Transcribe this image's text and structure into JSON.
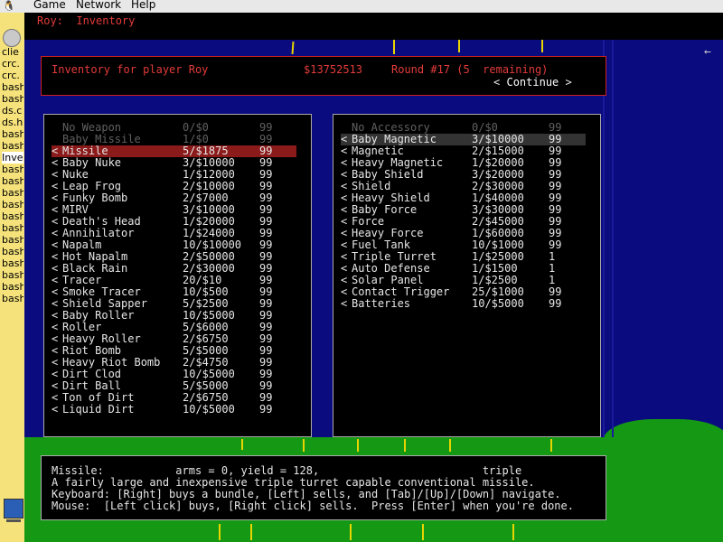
{
  "menubar": {
    "items": [
      "Game",
      "Network",
      "Help"
    ]
  },
  "taskbar": {
    "items": [
      "clie",
      "crc.",
      "crc.",
      "bash",
      "bash",
      "ds.c",
      "ds.h",
      "bash",
      "bash",
      "Inve",
      "bash",
      "bash",
      "bash",
      "bash",
      "bash",
      "bash",
      "bash",
      "bash",
      "bash",
      "bash",
      "bash",
      "bash"
    ]
  },
  "game": {
    "breadcrumb_player": "Roy:",
    "breadcrumb_section": "Inventory",
    "header": {
      "title": "Inventory for player Roy",
      "money": "$13752513",
      "round": "Round #17 (5  remaining)",
      "continue_label": "Continue"
    },
    "weapons": [
      {
        "name": "No Weapon",
        "price": "0/$0",
        "qty": "99",
        "state": "dim"
      },
      {
        "name": "Baby Missile",
        "price": "1/$0",
        "qty": "99",
        "state": "dim"
      },
      {
        "name": "Missile",
        "price": "5/$1875",
        "qty": "99",
        "state": "sel"
      },
      {
        "name": "Baby Nuke",
        "price": "3/$10000",
        "qty": "99",
        "state": ""
      },
      {
        "name": "Nuke",
        "price": "1/$12000",
        "qty": "99",
        "state": ""
      },
      {
        "name": "Leap Frog",
        "price": "2/$10000",
        "qty": "99",
        "state": ""
      },
      {
        "name": "Funky Bomb",
        "price": "2/$7000",
        "qty": "99",
        "state": ""
      },
      {
        "name": "MIRV",
        "price": "3/$10000",
        "qty": "99",
        "state": ""
      },
      {
        "name": "Death's Head",
        "price": "1/$20000",
        "qty": "99",
        "state": ""
      },
      {
        "name": "Annihilator",
        "price": "1/$24000",
        "qty": "99",
        "state": ""
      },
      {
        "name": "Napalm",
        "price": "10/$10000",
        "qty": "99",
        "state": ""
      },
      {
        "name": "Hot Napalm",
        "price": "2/$50000",
        "qty": "99",
        "state": ""
      },
      {
        "name": "Black Rain",
        "price": "2/$30000",
        "qty": "99",
        "state": ""
      },
      {
        "name": "Tracer",
        "price": "20/$10",
        "qty": "99",
        "state": ""
      },
      {
        "name": "Smoke Tracer",
        "price": "10/$500",
        "qty": "99",
        "state": ""
      },
      {
        "name": "Shield Sapper",
        "price": "5/$2500",
        "qty": "99",
        "state": ""
      },
      {
        "name": "Baby Roller",
        "price": "10/$5000",
        "qty": "99",
        "state": ""
      },
      {
        "name": "Roller",
        "price": "5/$6000",
        "qty": "99",
        "state": ""
      },
      {
        "name": "Heavy Roller",
        "price": "2/$6750",
        "qty": "99",
        "state": ""
      },
      {
        "name": "Riot Bomb",
        "price": "5/$5000",
        "qty": "99",
        "state": ""
      },
      {
        "name": "Heavy Riot Bomb",
        "price": "2/$4750",
        "qty": "99",
        "state": ""
      },
      {
        "name": "Dirt Clod",
        "price": "10/$5000",
        "qty": "99",
        "state": ""
      },
      {
        "name": "Dirt Ball",
        "price": "5/$5000",
        "qty": "99",
        "state": ""
      },
      {
        "name": "Ton of Dirt",
        "price": "2/$6750",
        "qty": "99",
        "state": ""
      },
      {
        "name": "Liquid Dirt",
        "price": "10/$5000",
        "qty": "99",
        "state": ""
      }
    ],
    "accessories": [
      {
        "name": "No Accessory",
        "price": "0/$0",
        "qty": "99",
        "state": "dim"
      },
      {
        "name": "Baby Magnetic",
        "price": "3/$10000",
        "qty": "99",
        "state": "hl"
      },
      {
        "name": "Magnetic",
        "price": "2/$15000",
        "qty": "99",
        "state": ""
      },
      {
        "name": "Heavy Magnetic",
        "price": "1/$20000",
        "qty": "99",
        "state": ""
      },
      {
        "name": "Baby Shield",
        "price": "3/$20000",
        "qty": "99",
        "state": ""
      },
      {
        "name": "Shield",
        "price": "2/$30000",
        "qty": "99",
        "state": ""
      },
      {
        "name": "Heavy Shield",
        "price": "1/$40000",
        "qty": "99",
        "state": ""
      },
      {
        "name": "Baby Force",
        "price": "3/$30000",
        "qty": "99",
        "state": ""
      },
      {
        "name": "Force",
        "price": "2/$45000",
        "qty": "99",
        "state": ""
      },
      {
        "name": "Heavy Force",
        "price": "1/$60000",
        "qty": "99",
        "state": ""
      },
      {
        "name": "Fuel Tank",
        "price": "10/$1000",
        "qty": "99",
        "state": ""
      },
      {
        "name": "Triple Turret",
        "price": "1/$25000",
        "qty": "1",
        "state": ""
      },
      {
        "name": "Auto Defense",
        "price": "1/$1500",
        "qty": "1",
        "state": ""
      },
      {
        "name": "Solar Panel",
        "price": "1/$2500",
        "qty": "1",
        "state": ""
      },
      {
        "name": "Contact Trigger",
        "price": "25/$1000",
        "qty": "99",
        "state": ""
      },
      {
        "name": "Batteries",
        "price": "10/$5000",
        "qty": "99",
        "state": ""
      }
    ],
    "info": {
      "line1": "Missile:           arms = 0, yield = 128,                         triple",
      "line2": "A fairly large and inexpensive triple turret capable conventional missile.",
      "line3": "Keyboard: [Right] buys a bundle, [Left] sells, and [Tab]/[Up]/[Down] navigate.",
      "line4": "Mouse:  [Left click] buys, [Right click] sells.  Press [Enter] when you're done."
    }
  },
  "icons": {
    "tux": "tux-icon",
    "sell_arrow": "<",
    "close": "←"
  },
  "colors": {
    "sky": "#0b0b80",
    "ground": "#159915",
    "accent_red": "#e33b3b",
    "selected_row": "#8b1a1a",
    "trace_yellow": "#e8d400"
  }
}
